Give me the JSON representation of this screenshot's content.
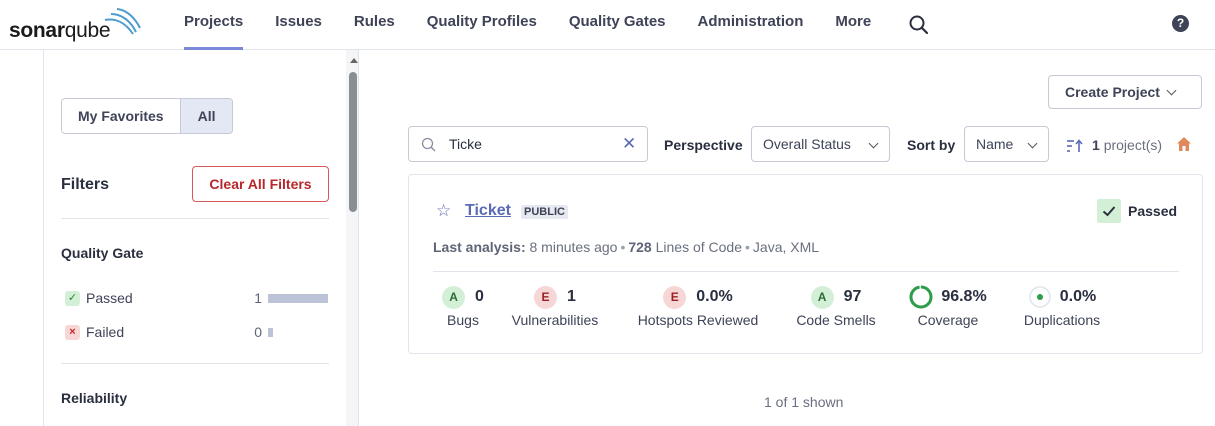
{
  "brand": {
    "logo_bold": "sonar",
    "logo_light": "qube"
  },
  "nav": {
    "items": [
      "Projects",
      "Issues",
      "Rules",
      "Quality Profiles",
      "Quality Gates",
      "Administration",
      "More"
    ],
    "active": "Projects",
    "help_glyph": "?"
  },
  "sidebar": {
    "favorites_label": "My Favorites",
    "all_label": "All",
    "filters_title": "Filters",
    "clear_all_label": "Clear All Filters",
    "quality_gate_title": "Quality Gate",
    "quality_gate_facets": [
      {
        "label": "Passed",
        "count": "1",
        "share": 1.0,
        "icon": "check-icon"
      },
      {
        "label": "Failed",
        "count": "0",
        "share": 0.0,
        "icon": "x-icon"
      }
    ],
    "reliability_title": "Reliability"
  },
  "toolbar": {
    "create_project_label": "Create Project",
    "search_value": "Ticke",
    "perspective_label": "Perspective",
    "perspective_value": "Overall Status",
    "sort_label": "Sort by",
    "sort_value": "Name",
    "project_count": "1",
    "project_count_suffix": "project(s)"
  },
  "project": {
    "name": "Ticket",
    "visibility": "PUBLIC",
    "quality_gate": "Passed",
    "last_analysis_label": "Last analysis:",
    "last_analysis_value": "8 minutes ago",
    "loc_value": "728",
    "loc_label": "Lines of Code",
    "languages": "Java, XML",
    "metrics": [
      {
        "rating": "A",
        "value": "0",
        "label": "Bugs"
      },
      {
        "rating": "E",
        "value": "1",
        "label": "Vulnerabilities"
      },
      {
        "rating": "E",
        "value": "0.0%",
        "label": "Hotspots Reviewed"
      },
      {
        "rating": "A",
        "value": "97",
        "label": "Code Smells"
      },
      {
        "value": "96.8%",
        "label": "Coverage",
        "coverage_fraction": 0.968
      },
      {
        "value": "0.0%",
        "label": "Duplications"
      }
    ]
  },
  "footer": {
    "shown_text": "1 of 1 shown"
  },
  "colors": {
    "accent": "#5b6ab5",
    "nav_underline": "#7b87d9",
    "passed_green": "#2e7d32",
    "danger_red": "#b7272b"
  }
}
